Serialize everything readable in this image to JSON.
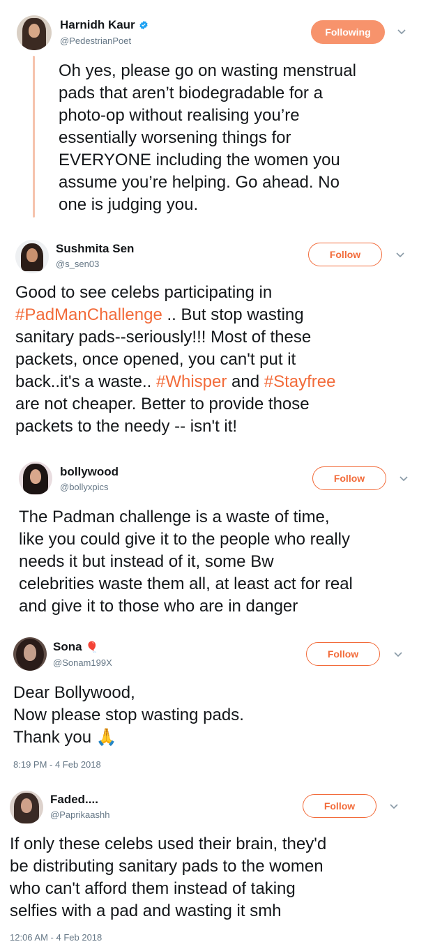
{
  "tweets": [
    {
      "name": "Harnidh Kaur",
      "handle": "@PedestrianPoet",
      "button": "Following",
      "verified": true,
      "lines": [
        "Oh yes, please go on wasting menstrual",
        "pads that aren’t biodegradable for a",
        "photo-op without realising you’re",
        "essentially worsening things for",
        "EVERYONE including the women you",
        "assume you’re helping. Go ahead. No",
        "one is judging you."
      ]
    },
    {
      "name": "Sushmita Sen",
      "handle": "@s_sen03",
      "button": "Follow",
      "line1": "Good to see celebs participating in",
      "line2_tag": "#PadManChallenge",
      "line2_rest": " .. But stop wasting",
      "line3": "sanitary pads--seriously!!! Most of these",
      "line4": "packets, once opened, you can't put it",
      "line5_pre": "back..it's a waste.. ",
      "line5_tag1": "#Whisper",
      "line5_mid": " and ",
      "line5_tag2": "#Stayfree",
      "line6": "are not cheaper. Better to provide those",
      "line7": "packets to the needy -- isn't it!"
    },
    {
      "name": "bollywood",
      "handle": "@bollyxpics",
      "button": "Follow",
      "lines": [
        "The Padman challenge is a waste of time,",
        "like you could give it to the people who really",
        "needs it but instead of it, some Bw",
        "celebrities waste them all, at least act for real",
        "and give it to those who are in danger"
      ]
    },
    {
      "name": "Sona",
      "name_emoji": "🎈",
      "handle": "@Sonam199X",
      "button": "Follow",
      "lines": [
        "Dear Bollywood,",
        "Now please stop wasting pads.",
        "Thank you"
      ],
      "emoji": "🙏",
      "time": "8:19 PM - 4 Feb 2018"
    },
    {
      "name": "Faded....",
      "handle": "@Paprikaashh",
      "button": "Follow",
      "lines": [
        "If only these celebs used their brain, they'd",
        "be distributing sanitary pads to the women",
        "who can't afford them instead of taking",
        "selfies with a pad and wasting it smh"
      ],
      "time": "12:06 AM - 4 Feb 2018"
    }
  ],
  "colors": {
    "accent": "#f26b3a",
    "following_bg": "#f7936c",
    "thread_line": "#f6c3ad",
    "verified": "#1da1f2"
  },
  "icons": [
    "verified-badge-icon",
    "chevron-down-icon",
    "avatar"
  ]
}
